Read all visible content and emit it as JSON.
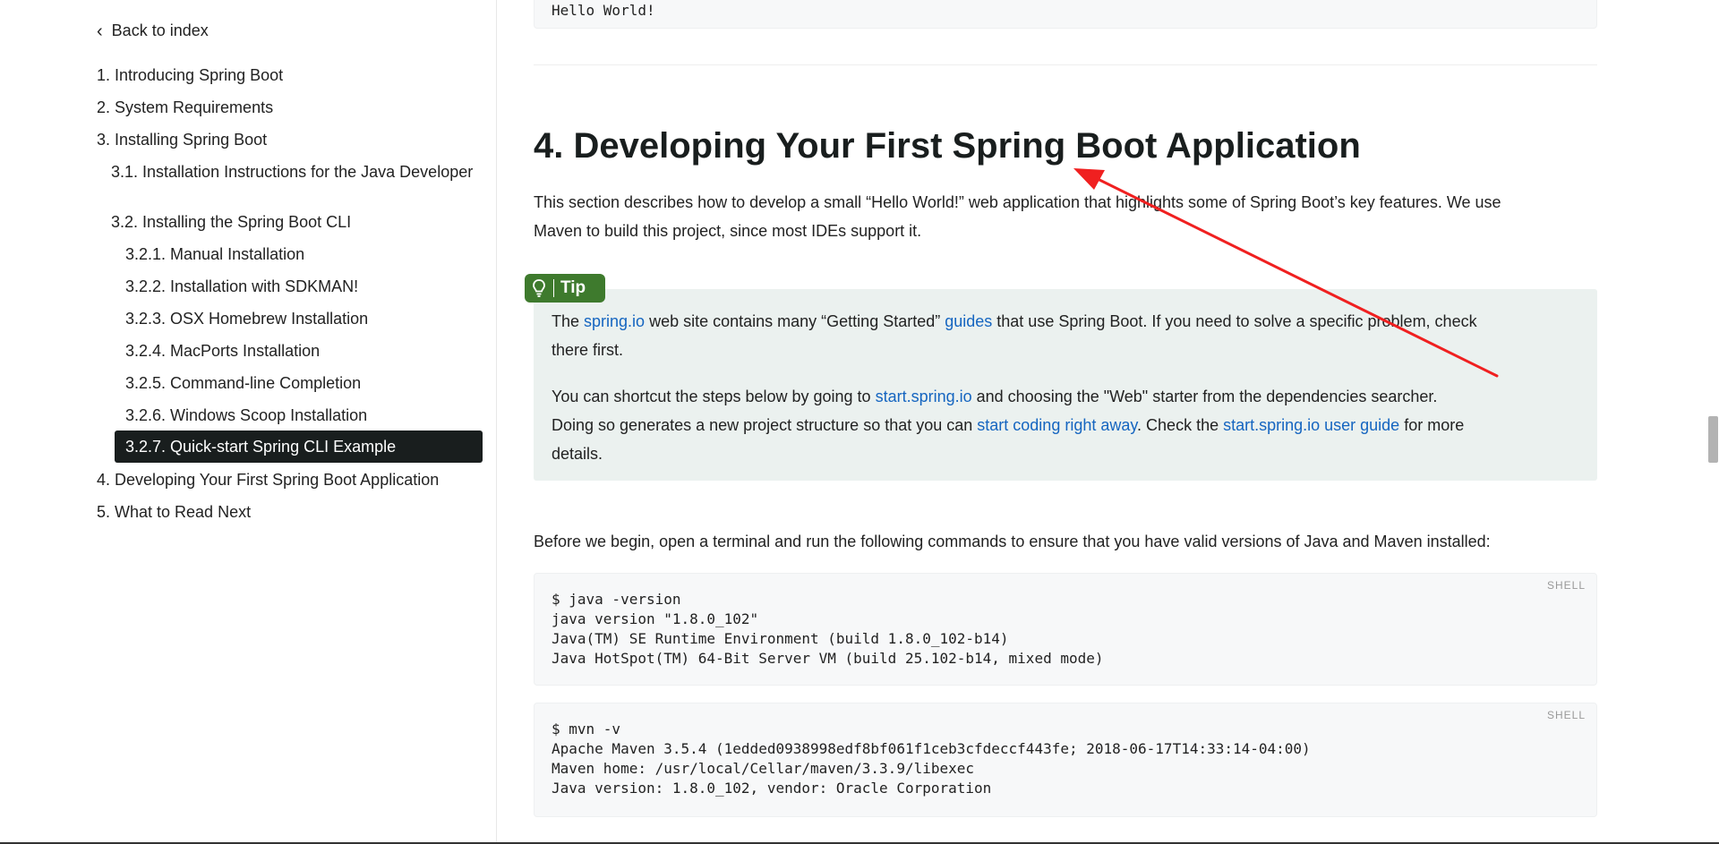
{
  "sidebar": {
    "back_label": "Back to index",
    "items": [
      {
        "label": "1. Introducing Spring Boot"
      },
      {
        "label": "2. System Requirements"
      },
      {
        "label": "3. Installing Spring Boot"
      },
      {
        "label": "3.1. Installation Instructions for the Java Developer"
      },
      {
        "label": "3.2. Installing the Spring Boot CLI"
      },
      {
        "label": "3.2.1. Manual Installation"
      },
      {
        "label": "3.2.2. Installation with SDKMAN!"
      },
      {
        "label": "3.2.3. OSX Homebrew Installation"
      },
      {
        "label": "3.2.4. MacPorts Installation"
      },
      {
        "label": "3.2.5. Command-line Completion"
      },
      {
        "label": "3.2.6. Windows Scoop Installation"
      },
      {
        "label": "3.2.7. Quick-start Spring CLI Example",
        "active": true
      },
      {
        "label": "4. Developing Your First Spring Boot Application"
      },
      {
        "label": "5. What to Read Next"
      }
    ]
  },
  "main": {
    "top_code_fragment": "Hello World!",
    "section_title": "4. Developing Your First Spring Boot Application",
    "intro_line1": "This section describes how to develop a small “Hello World!” web application that highlights some of Spring Boot’s key features. We use",
    "intro_line2": "Maven to build this project, since most IDEs support it.",
    "tip": {
      "badge_label": "Tip",
      "p1_a": "The ",
      "p1_link1": "spring.io",
      "p1_b": " web site contains many “Getting Started” ",
      "p1_link2": "guides",
      "p1_c": " that use Spring Boot. If you need to solve a specific problem, check",
      "p1_line2": "there first.",
      "p2_a": "You can shortcut the steps below by going to ",
      "p2_link1": "start.spring.io",
      "p2_b": " and choosing the \"Web\" starter from the dependencies searcher.",
      "p2_c": "Doing so generates a new project structure so that you can ",
      "p2_link2": "start coding right away",
      "p2_d": ". Check the ",
      "p2_link3": "start.spring.io user guide",
      "p2_e": " for more",
      "p2_line3": "details."
    },
    "before_begin": "Before we begin, open a terminal and run the following commands to ensure that you have valid versions of Java and Maven installed:",
    "code_blocks": [
      {
        "lang": "SHELL",
        "lines": [
          "$ java -version",
          "java version \"1.8.0_102\"",
          "Java(TM) SE Runtime Environment (build 1.8.0_102-b14)",
          "Java HotSpot(TM) 64-Bit Server VM (build 25.102-b14, mixed mode)"
        ]
      },
      {
        "lang": "SHELL",
        "lines": [
          "$ mvn -v",
          "Apache Maven 3.5.4 (1edded0938998edf8bf061f1ceb3cfdeccf443fe; 2018-06-17T14:33:14-04:00)",
          "Maven home: /usr/local/Cellar/maven/3.3.9/libexec",
          "Java version: 1.8.0_102, vendor: Oracle Corporation"
        ]
      }
    ]
  },
  "colors": {
    "link": "#1565c0",
    "tip_badge": "#3e7a2d",
    "tip_bg": "#ebf1ef",
    "active_item_bg": "#191e1e",
    "annotation_arrow": "#f02020"
  },
  "icons": {
    "back": "chevron-left-icon",
    "tip": "lightbulb-icon"
  }
}
